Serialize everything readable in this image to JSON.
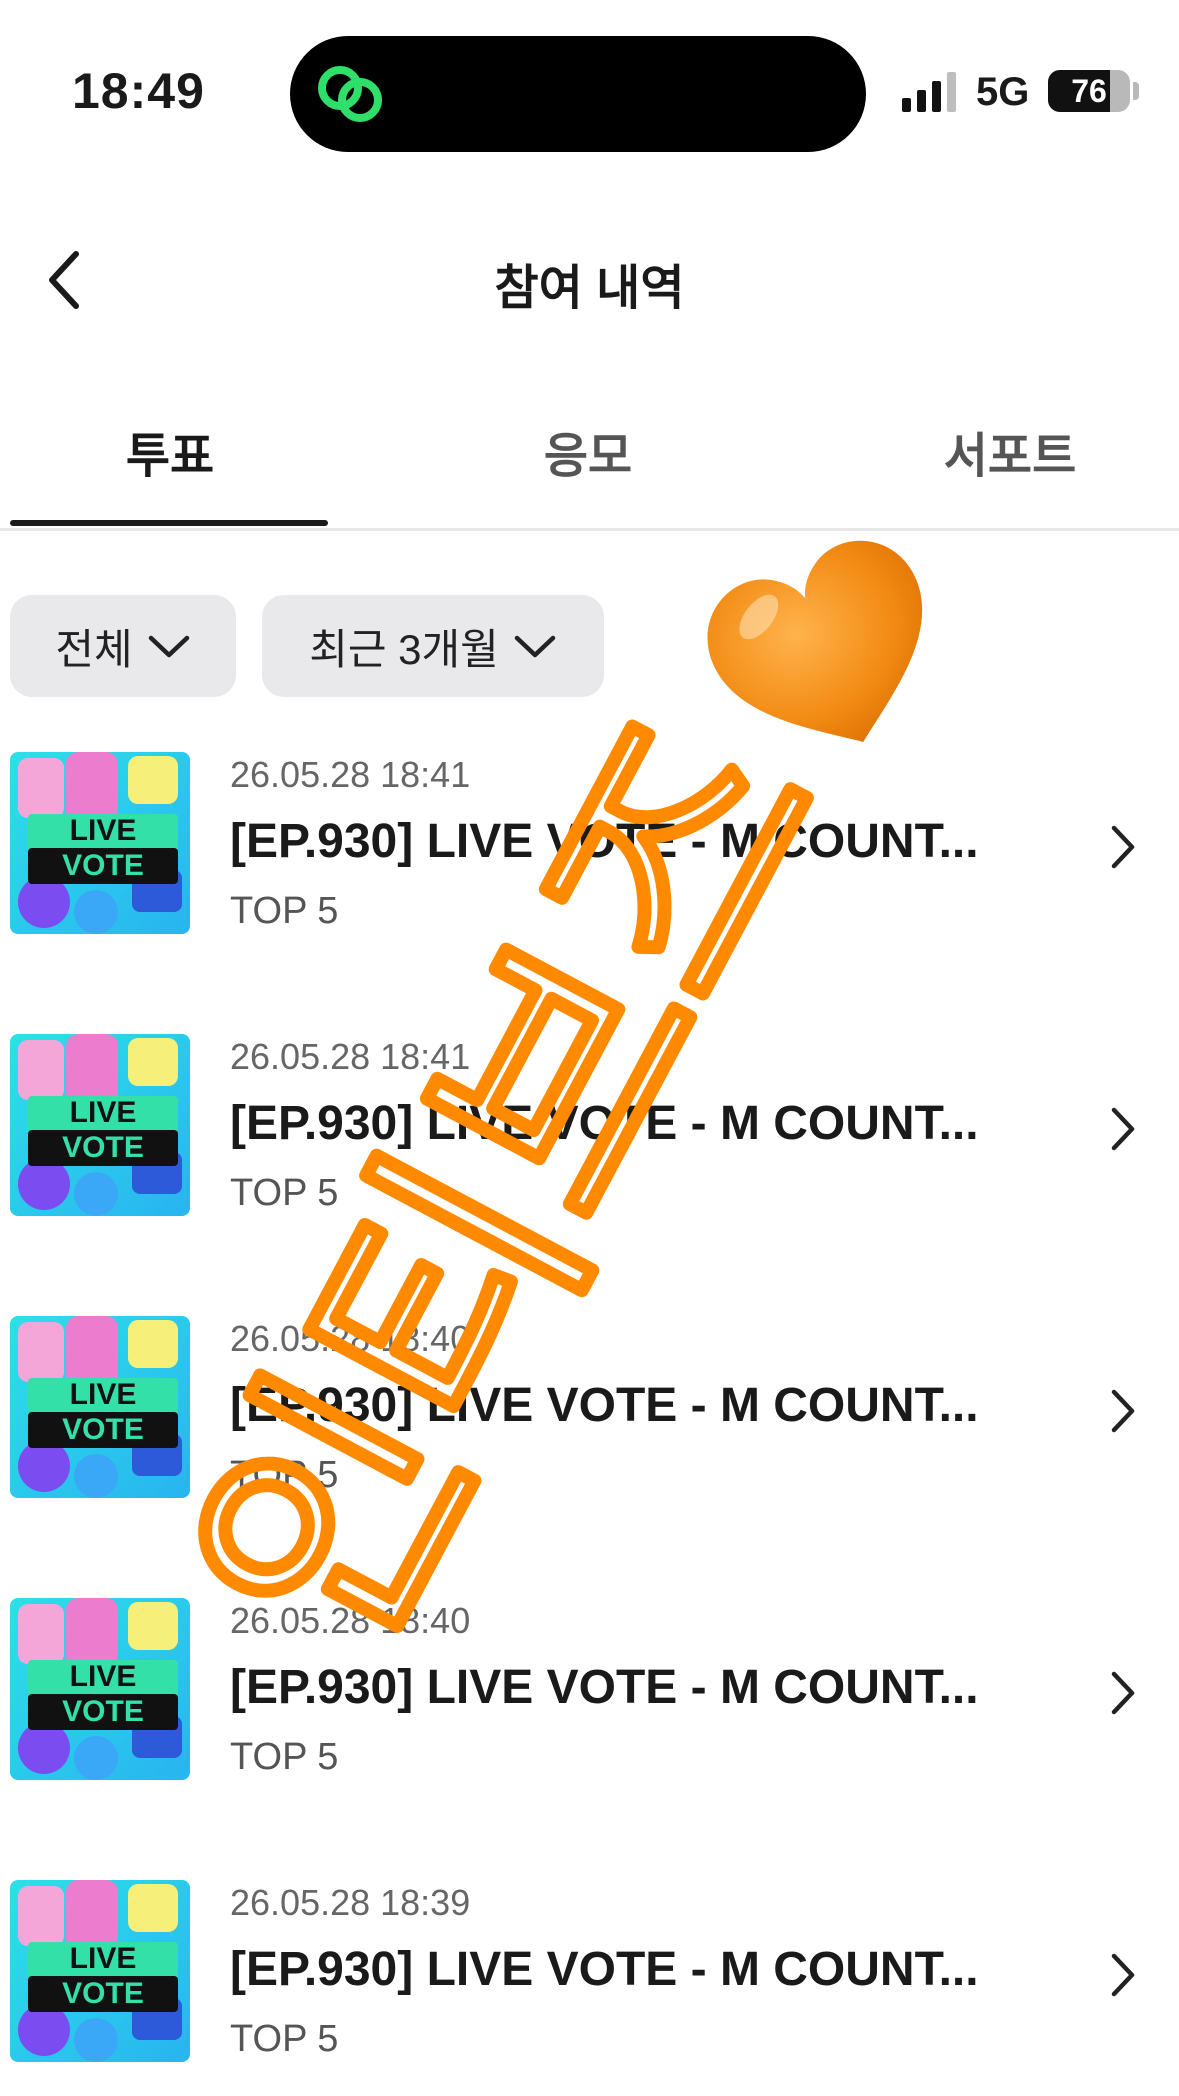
{
  "status_bar": {
    "time": "18:49",
    "network": "5G",
    "battery": "76",
    "battery_fraction": 0.76
  },
  "header": {
    "title": "참여 내역"
  },
  "tabs": [
    {
      "label": "투표",
      "active": true
    },
    {
      "label": "응모",
      "active": false
    },
    {
      "label": "서포트",
      "active": false
    }
  ],
  "filters": {
    "category": "전체",
    "period": "최근 3개월"
  },
  "items": [
    {
      "date": "26.05.28 18:41",
      "title": "[EP.930] LIVE VOTE - M COUNT...",
      "subtitle": "TOP 5",
      "thumb_text": [
        "LIVE",
        "VOTE"
      ]
    },
    {
      "date": "26.05.28 18:41",
      "title": "[EP.930] LIVE VOTE - M COUNT...",
      "subtitle": "TOP 5",
      "thumb_text": [
        "LIVE",
        "VOTE"
      ]
    },
    {
      "date": "26.05.28 18:40",
      "title": "[EP.930] LIVE VOTE - M COUNT...",
      "subtitle": "TOP 5",
      "thumb_text": [
        "LIVE",
        "VOTE"
      ]
    },
    {
      "date": "26.05.28 18:40",
      "title": "[EP.930] LIVE VOTE - M COUNT...",
      "subtitle": "TOP 5",
      "thumb_text": [
        "LIVE",
        "VOTE"
      ]
    },
    {
      "date": "26.05.28 18:39",
      "title": "[EP.930] LIVE VOTE - M COUNT...",
      "subtitle": "TOP 5",
      "thumb_text": [
        "LIVE",
        "VOTE"
      ]
    }
  ],
  "watermark": {
    "text": "인티브즈",
    "color": "#ff8a00",
    "heart_color": "#f28a12"
  }
}
